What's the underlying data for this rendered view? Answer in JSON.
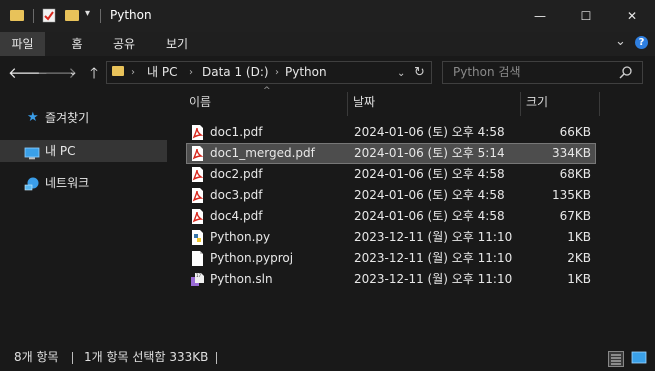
{
  "window": {
    "title": "Python",
    "controls": {
      "minimize": "—",
      "maximize": "☐",
      "close": "✕"
    }
  },
  "ribbon": {
    "tabs": [
      "파일",
      "홈",
      "공유",
      "보기"
    ],
    "active_tab": "파일",
    "collapse": "⌄",
    "help": "?"
  },
  "address": {
    "crumbs": [
      "내 PC",
      "Data 1 (D:)",
      "Python"
    ],
    "search_placeholder": "Python 검색"
  },
  "nav": {
    "items": [
      {
        "label": "즐겨찾기",
        "icon": "star-icon"
      },
      {
        "label": "내 PC",
        "icon": "pc-icon",
        "selected": true
      },
      {
        "label": "네트워크",
        "icon": "network-icon"
      }
    ]
  },
  "columns": {
    "name": "이름",
    "date": "날짜",
    "size": "크기"
  },
  "files": [
    {
      "name": "doc1.pdf",
      "date": "2024-01-06 (토) 오후 4:58",
      "size": "66KB",
      "icon": "pdf-icon"
    },
    {
      "name": "doc1_merged.pdf",
      "date": "2024-01-06 (토) 오후 5:14",
      "size": "334KB",
      "icon": "pdf-icon",
      "selected": true
    },
    {
      "name": "doc2.pdf",
      "date": "2024-01-06 (토) 오후 4:58",
      "size": "68KB",
      "icon": "pdf-icon"
    },
    {
      "name": "doc3.pdf",
      "date": "2024-01-06 (토) 오후 4:58",
      "size": "135KB",
      "icon": "pdf-icon"
    },
    {
      "name": "doc4.pdf",
      "date": "2024-01-06 (토) 오후 4:58",
      "size": "67KB",
      "icon": "pdf-icon"
    },
    {
      "name": "Python.py",
      "date": "2023-12-11 (월) 오후 11:10",
      "size": "1KB",
      "icon": "python-file-icon"
    },
    {
      "name": "Python.pyproj",
      "date": "2023-12-11 (월) 오후 11:10",
      "size": "2KB",
      "icon": "blank-file-icon"
    },
    {
      "name": "Python.sln",
      "date": "2023-12-11 (월) 오후 11:10",
      "size": "1KB",
      "icon": "solution-file-icon"
    }
  ],
  "status": {
    "item_count": "8개 항목",
    "selection": "1개 항목 선택함 333KB"
  },
  "colors": {
    "accent_folder": "#e8c25a",
    "pdf_red": "#d9281e",
    "background": "#191919"
  }
}
